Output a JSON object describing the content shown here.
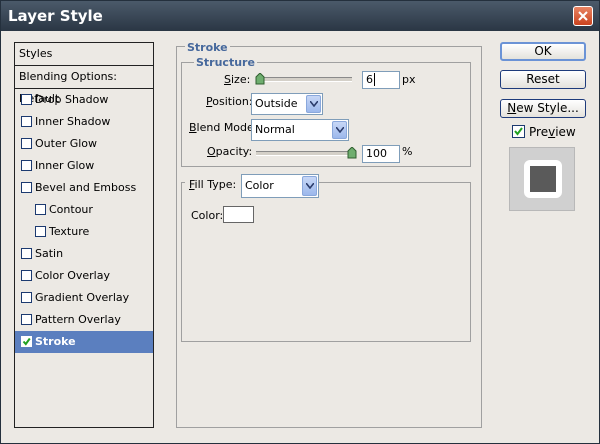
{
  "window": {
    "title": "Layer Style"
  },
  "styles_list": {
    "header": "Styles",
    "blending_options": "Blending Options: Default",
    "items": [
      {
        "label": "Drop Shadow",
        "checked": false,
        "indent": false
      },
      {
        "label": "Inner Shadow",
        "checked": false,
        "indent": false
      },
      {
        "label": "Outer Glow",
        "checked": false,
        "indent": false
      },
      {
        "label": "Inner Glow",
        "checked": false,
        "indent": false
      },
      {
        "label": "Bevel and Emboss",
        "checked": false,
        "indent": false
      },
      {
        "label": "Contour",
        "checked": false,
        "indent": true
      },
      {
        "label": "Texture",
        "checked": false,
        "indent": true
      },
      {
        "label": "Satin",
        "checked": false,
        "indent": false
      },
      {
        "label": "Color Overlay",
        "checked": false,
        "indent": false
      },
      {
        "label": "Gradient Overlay",
        "checked": false,
        "indent": false
      },
      {
        "label": "Pattern Overlay",
        "checked": false,
        "indent": false
      },
      {
        "label": "Stroke",
        "checked": true,
        "indent": false,
        "selected": true
      }
    ]
  },
  "stroke": {
    "group_title": "Stroke",
    "structure_title": "Structure",
    "size": {
      "label": "Size:",
      "value": "6",
      "unit": "px",
      "slider_fraction": 0.0
    },
    "position": {
      "label": "Position:",
      "value": "Outside"
    },
    "blend_mode": {
      "label": "Blend Mode:",
      "value": "Normal"
    },
    "opacity": {
      "label": "Opacity:",
      "value": "100",
      "unit": "%",
      "slider_fraction": 1.0
    },
    "fill_type": {
      "label": "Fill Type:",
      "value": "Color"
    },
    "color": {
      "label": "Color:",
      "swatch": "#ffffff"
    }
  },
  "buttons": {
    "ok": "OK",
    "reset": "Reset",
    "new_style": "New Style...",
    "preview_label": "Preview",
    "preview_checked": true
  },
  "colors": {
    "selected_row": "#5b7fbf",
    "group_title": "#46689c",
    "preview_fill": "#5a5a5a"
  }
}
